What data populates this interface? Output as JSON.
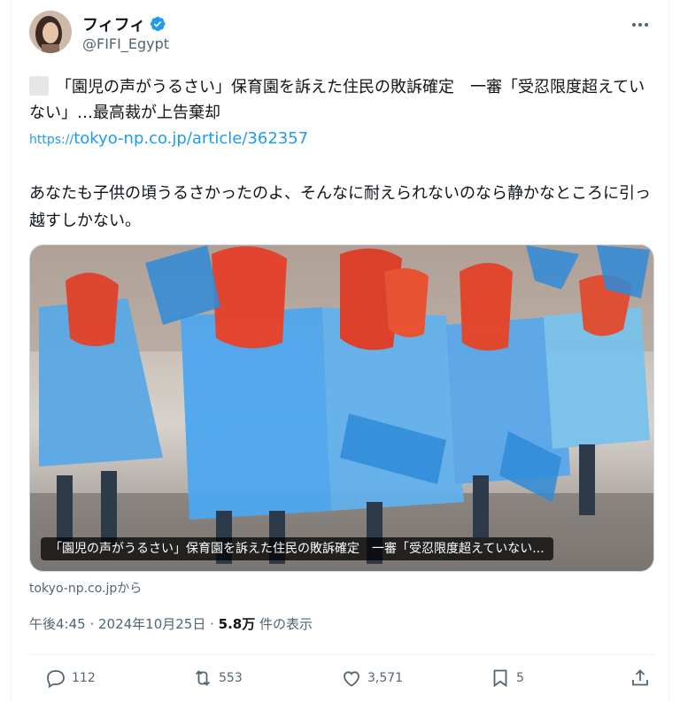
{
  "author": {
    "display_name": "フィフィ",
    "handle": "@FIFI_Egypt",
    "avatar_icon": "avatar",
    "verified_icon": "verified-badge-icon"
  },
  "tweet": {
    "headline": "「園児の声がうるさい」保育園を訴えた住民の敗訴確定　一審「受忍限度超えていない」…最高裁が上告棄却",
    "link_protocol": "https://",
    "link_text": "tokyo-np.co.jp/article/362357",
    "comment": "あなたも子供の頃うるさかったのよ、そんなに耐えられないのなら静かなところに引っ越すしかない。"
  },
  "card": {
    "caption": "「園児の声がうるさい」保育園を訴えた住民の敗訴確定　一審「受忍限度超えていない...",
    "source": "tokyo-np.co.jpから"
  },
  "meta": {
    "time": "午後4:45",
    "sep1": " · ",
    "date": "2024年10月25日",
    "sep2": " · ",
    "views": "5.8万",
    "views_label": " 件の表示"
  },
  "actions": {
    "replies": "112",
    "reposts": "553",
    "likes": "3,571",
    "bookmarks": "5"
  },
  "colors": {
    "link": "#1d9bf0",
    "muted": "#536471",
    "verified": "#1d9bf0",
    "border": "#eff3f4"
  }
}
